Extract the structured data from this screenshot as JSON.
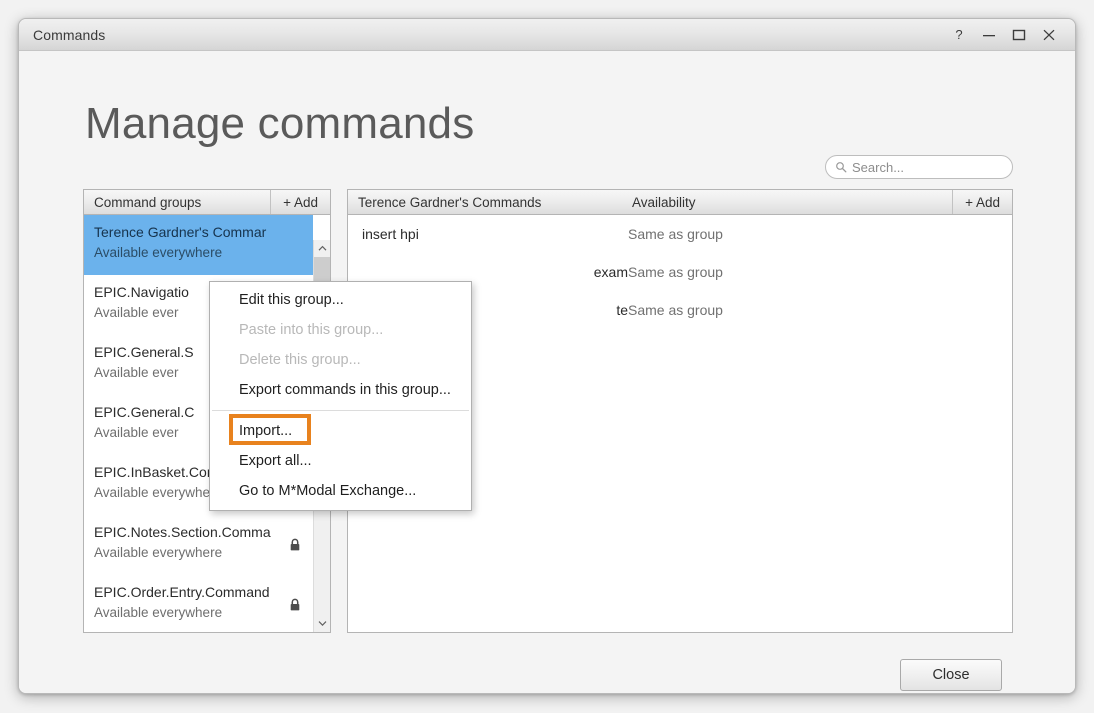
{
  "window": {
    "title": "Commands",
    "controls": [
      {
        "name": "help-button",
        "glyph": "?"
      },
      {
        "name": "minimize-button",
        "glyph": "—"
      },
      {
        "name": "maximize-button",
        "glyph": "▢"
      },
      {
        "name": "close-button",
        "glyph": "✕"
      }
    ]
  },
  "page": {
    "title": "Manage commands"
  },
  "search": {
    "placeholder": "Search...",
    "value": "",
    "icon": "search-icon"
  },
  "left_panel": {
    "header": "Command groups",
    "add_label": "+ Add",
    "items": [
      {
        "name": "Terence Gardner's Commar",
        "availability": "Available everywhere",
        "locked": false,
        "selected": true
      },
      {
        "name": "EPIC.Navigatio",
        "availability": "Available ever",
        "locked": false,
        "selected": false
      },
      {
        "name": "EPIC.General.S",
        "availability": "Available ever",
        "locked": false,
        "selected": false
      },
      {
        "name": "EPIC.General.C",
        "availability": "Available ever",
        "locked": false,
        "selected": false
      },
      {
        "name": "EPIC.InBasket.Commands",
        "availability": "Available everywhere",
        "locked": true,
        "selected": false
      },
      {
        "name": "EPIC.Notes.Section.Comma",
        "availability": "Available everywhere",
        "locked": true,
        "selected": false
      },
      {
        "name": "EPIC.Order.Entry.Command",
        "availability": "Available everywhere",
        "locked": true,
        "selected": false
      }
    ]
  },
  "right_panel": {
    "header_name": "Terence Gardner's Commands",
    "header_availability": "Availability",
    "add_label": "+ Add",
    "rows": [
      {
        "name": "insert hpi",
        "availability": "Same as group"
      },
      {
        "name": "exam",
        "availability": "Same as group"
      },
      {
        "name": "te",
        "availability": "Same as group"
      }
    ]
  },
  "context_menu": {
    "items": [
      {
        "label": "Edit this group...",
        "disabled": false,
        "highlighted": false,
        "separator_after": false
      },
      {
        "label": "Paste into this group...",
        "disabled": true,
        "highlighted": false,
        "separator_after": false
      },
      {
        "label": "Delete this group...",
        "disabled": true,
        "highlighted": false,
        "separator_after": false
      },
      {
        "label": "Export commands in this group...",
        "disabled": false,
        "highlighted": false,
        "separator_after": true
      },
      {
        "label": "Import...",
        "disabled": false,
        "highlighted": true,
        "separator_after": false
      },
      {
        "label": "Export all...",
        "disabled": false,
        "highlighted": false,
        "separator_after": false
      },
      {
        "label": "Go to M*Modal Exchange...",
        "disabled": false,
        "highlighted": false,
        "separator_after": false
      }
    ]
  },
  "footer": {
    "close_label": "Close"
  },
  "colors": {
    "selection_blue": "#6bb2ec",
    "highlight_orange": "#e8821e",
    "panel_border": "#b4b4b4",
    "window_bg": "#f4f4f4"
  }
}
